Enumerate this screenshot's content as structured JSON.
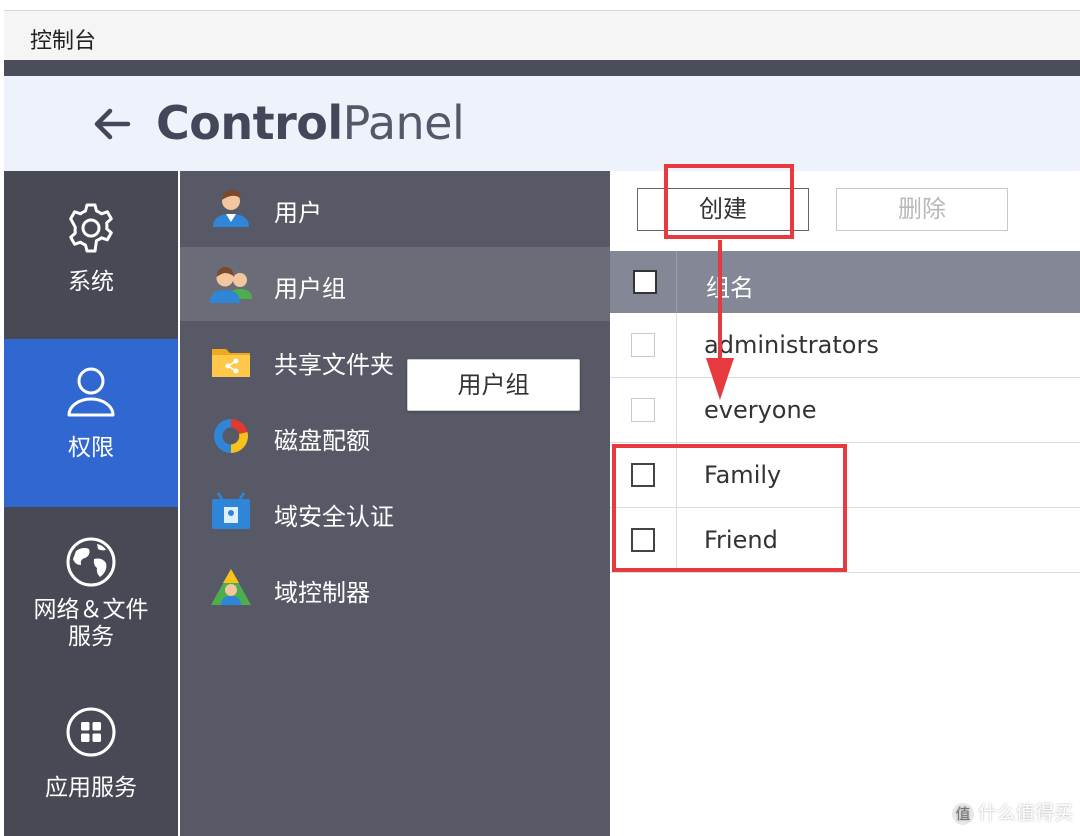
{
  "window": {
    "title": "控制台"
  },
  "header": {
    "title_bold": "Control",
    "title_normal": "Panel"
  },
  "rail": {
    "items": [
      {
        "label": "系统",
        "icon": "gear-icon"
      },
      {
        "label": "权限",
        "icon": "user-icon",
        "active": true
      },
      {
        "label_line1": "网络＆文件",
        "label_line2": "服务",
        "icon": "globe-icon"
      },
      {
        "label": "应用服务",
        "icon": "grid-icon"
      }
    ]
  },
  "subnav": {
    "items": [
      {
        "label": "用户",
        "icon": "user-avatar-icon"
      },
      {
        "label": "用户组",
        "icon": "user-group-icon",
        "active": true
      },
      {
        "label": "共享文件夹",
        "icon": "shared-folder-icon"
      },
      {
        "label": "磁盘配额",
        "icon": "disk-quota-icon"
      },
      {
        "label": "域安全认证",
        "icon": "domain-security-icon"
      },
      {
        "label": "域控制器",
        "icon": "domain-controller-icon"
      }
    ],
    "tooltip": "用户组"
  },
  "toolbar": {
    "create_label": "创建",
    "delete_label": "删除"
  },
  "table": {
    "header": "组名",
    "rows": [
      "administrators",
      "everyone",
      "Family",
      "Friend"
    ]
  },
  "watermark": "什么值得买",
  "colors": {
    "accent": "#3167d0",
    "annotation": "#e63a3f"
  }
}
